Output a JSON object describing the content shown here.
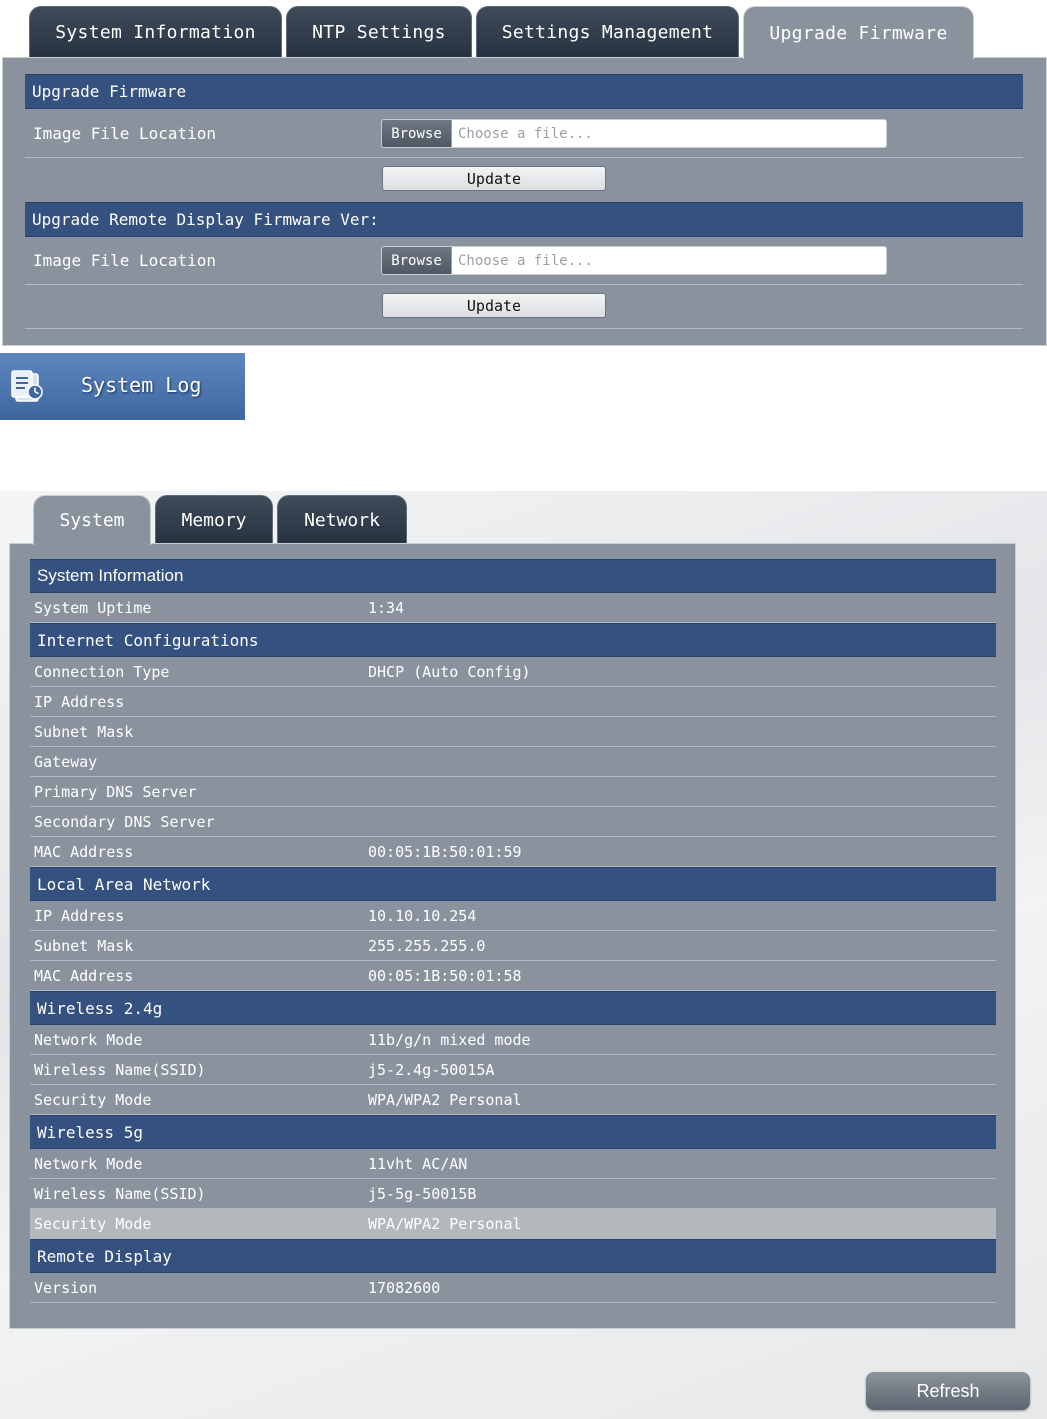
{
  "top_tabs": [
    {
      "label": "System Information"
    },
    {
      "label": "NTP Settings"
    },
    {
      "label": "Settings Management"
    },
    {
      "label": "Upgrade Firmware",
      "active": true
    }
  ],
  "firmware": {
    "section1_title": "Upgrade Firmware",
    "section1_label": "Image File Location",
    "section2_title": "Upgrade Remote Display Firmware Ver:",
    "section2_label": "Image File Location",
    "browse_label": "Browse",
    "file_placeholder": "Choose a file...",
    "update_label": "Update"
  },
  "system_log": {
    "label": "System Log",
    "icon": "log-file-icon"
  },
  "bottom_tabs": [
    {
      "label": "System",
      "active": true
    },
    {
      "label": "Memory"
    },
    {
      "label": "Network"
    }
  ],
  "status": {
    "system_info_title": "System Information",
    "uptime_label": "System Uptime",
    "uptime_value": "1:34",
    "internet_title": "Internet Configurations",
    "internet_rows": [
      {
        "label": "Connection Type",
        "value": "DHCP (Auto Config)"
      },
      {
        "label": "IP Address",
        "value": ""
      },
      {
        "label": "Subnet Mask",
        "value": ""
      },
      {
        "label": "Gateway",
        "value": ""
      },
      {
        "label": "Primary DNS Server",
        "value": ""
      },
      {
        "label": "Secondary DNS Server",
        "value": ""
      },
      {
        "label": "MAC Address",
        "value": "00:05:1B:50:01:59"
      }
    ],
    "lan_title": "Local Area Network",
    "lan_rows": [
      {
        "label": "IP Address",
        "value": "10.10.10.254"
      },
      {
        "label": "Subnet Mask",
        "value": "255.255.255.0"
      },
      {
        "label": "MAC Address",
        "value": "00:05:1B:50:01:58"
      }
    ],
    "wireless24_title": "Wireless 2.4g",
    "wireless24_rows": [
      {
        "label": "Network Mode",
        "value": "11b/g/n mixed mode"
      },
      {
        "label": "Wireless Name(SSID)",
        "value": "j5-2.4g-50015A"
      },
      {
        "label": "Security Mode",
        "value": "WPA/WPA2 Personal"
      }
    ],
    "wireless5_title": "Wireless 5g",
    "wireless5_rows": [
      {
        "label": "Network Mode",
        "value": "11vht AC/AN"
      },
      {
        "label": "Wireless Name(SSID)",
        "value": "j5-5g-50015B"
      },
      {
        "label": "Security Mode",
        "value": "WPA/WPA2 Personal"
      }
    ],
    "remote_title": "Remote Display",
    "remote_rows": [
      {
        "label": "Version",
        "value": "17082600"
      }
    ]
  },
  "refresh_label": "Refresh",
  "colors": {
    "panel_bg": "#8a939d",
    "section_header": "#34517f",
    "tab_dark": "#273240",
    "banner_blue": "#4a73ab"
  }
}
